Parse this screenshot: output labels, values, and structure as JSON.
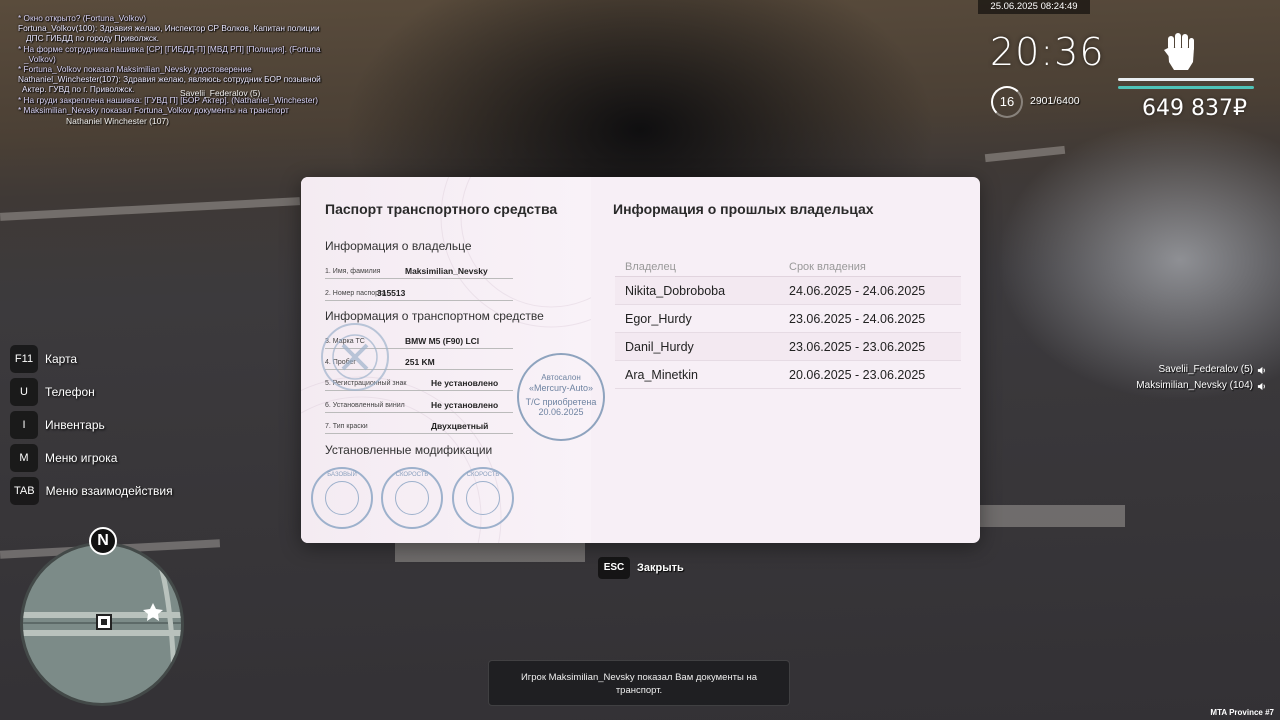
{
  "chat": [
    "* Окно открыто? (Fortuna_Volkov)",
    "Fortuna_Volkov(100): Здравия желаю, Инспектор СР Волков, Капитан полиции",
    "ДПС ГИБДД по городу Приволжск.",
    "* На форме сотрудника нашивка [СР] [ГИБДД-П] [МВД РП] [Полиция]. (Fortuna",
    "_Volkov)",
    "* Fortuna_Volkov показал Maksimilian_Nevsky удостоверение",
    "Nathaniel_Winchester(107): Здравия желаю, являюсь сотрудник БОР позывной",
    "Актер. ГУВД по г. Приволжск.",
    "* На груди закреплена нашивка: [ГУВД П] [БОР Актер]. (Nathaniel_Winchester)",
    "* Maksimilian_Nevsky показал Fortuna_Volkov документы на транспорт"
  ],
  "nametags": {
    "savelii": "Savelii_Federalov (5)",
    "nathaniel": "Nathaniel Winchester (107)"
  },
  "hud": {
    "datetime": "25.06.2025 08:24:49",
    "clock": "20:36",
    "level": "16",
    "xp": "2901/6400",
    "money": "649 837₽",
    "colors": {
      "health": "#e9eef2",
      "armor": "#4ec3b8"
    }
  },
  "keymenu": [
    {
      "key": "F11",
      "label": "Карта"
    },
    {
      "key": "U",
      "label": "Телефон"
    },
    {
      "key": "I",
      "label": "Инвентарь"
    },
    {
      "key": "M",
      "label": "Меню игрока"
    },
    {
      "key": "TAB",
      "label": "Меню взаимодействия"
    }
  ],
  "minimap": {
    "compass": "N"
  },
  "players": [
    {
      "name": "Savelii_Federalov (5)",
      "icon": "speaker-icon"
    },
    {
      "name": "Maksimilian_Nevsky (104)",
      "icon": "speaker-icon"
    }
  ],
  "passport": {
    "title": "Паспорт транспортного средства",
    "owner_section": "Информация о владельце",
    "owner_fields": [
      {
        "label": "1. Имя, фамилия",
        "value": "Maksimilian_Nevsky"
      },
      {
        "label": "2. Номер паспорта",
        "value": "315513"
      }
    ],
    "vehicle_section": "Информация о транспортном средстве",
    "vehicle_fields": [
      {
        "label": "3. Марка ТС",
        "value": "BMW M5 (F90) LCI"
      },
      {
        "label": "4. Пробег",
        "value": "251 KM"
      },
      {
        "label": "5. Регистрационный знак",
        "value": "Не установлено"
      },
      {
        "label": "6. Установленный винил",
        "value": "Не установлено"
      },
      {
        "label": "7. Тип краски",
        "value": "Двухцветный"
      }
    ],
    "salon_stamp": {
      "line1": "Автосалон",
      "line2": "«Mercury-Auto»",
      "line3": "Т/С приобретена",
      "line4": "20.06.2025"
    },
    "mods_section": "Установленные модификации",
    "mod_stamps": [
      "БАЗОВЫЙ",
      "СКОРОСТЬ",
      "СКОРОСТЬ"
    ]
  },
  "owners": {
    "title": "Информация о прошлых владельцах",
    "col_owner": "Владелец",
    "col_period": "Срок владения",
    "rows": [
      {
        "owner": "Nikita_Dobroboba",
        "period": "24.06.2025 - 24.06.2025"
      },
      {
        "owner": "Egor_Hurdy",
        "period": "23.06.2025 - 24.06.2025"
      },
      {
        "owner": "Danil_Hurdy",
        "period": "23.06.2025 - 23.06.2025"
      },
      {
        "owner": "Ara_Minetkin",
        "period": "20.06.2025 - 23.06.2025"
      }
    ]
  },
  "close": {
    "key": "ESC",
    "label": "Закрыть"
  },
  "notice": "Игрок Maksimilian_Nevsky показал Вам документы на транспорт.",
  "server": "MTA Province #7"
}
